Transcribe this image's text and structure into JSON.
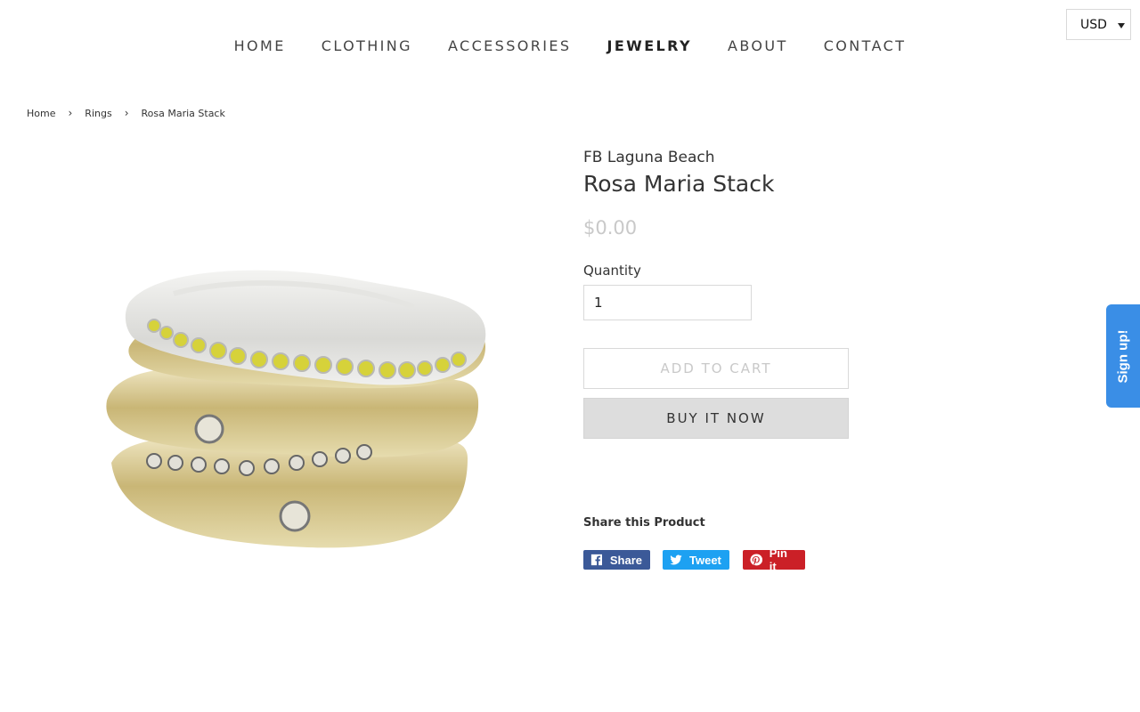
{
  "currency": {
    "selected": "USD"
  },
  "nav": {
    "items": [
      {
        "label": "HOME"
      },
      {
        "label": "CLOTHING"
      },
      {
        "label": "ACCESSORIES"
      },
      {
        "label": "JEWELRY",
        "active": true
      },
      {
        "label": "ABOUT"
      },
      {
        "label": "CONTACT"
      }
    ]
  },
  "breadcrumb": {
    "items": [
      {
        "label": "Home"
      },
      {
        "label": "Rings"
      },
      {
        "label": "Rosa Maria Stack"
      }
    ],
    "separator": "›"
  },
  "product": {
    "vendor": "FB Laguna Beach",
    "title": "Rosa Maria Stack",
    "price": "$0.00",
    "quantity_label": "Quantity",
    "quantity_value": "1",
    "add_to_cart_label": "ADD TO CART",
    "buy_now_label": "BUY IT NOW",
    "image_icon": "ring-stack-image"
  },
  "share": {
    "title": "Share this Product",
    "facebook_label": "Share",
    "twitter_label": "Tweet",
    "pinterest_label": "Pin it",
    "colors": {
      "facebook": "#3b5998",
      "twitter": "#1da1f2",
      "pinterest": "#cb2027"
    }
  },
  "signup": {
    "label": "Sign up!",
    "color": "#3a8ee6"
  }
}
